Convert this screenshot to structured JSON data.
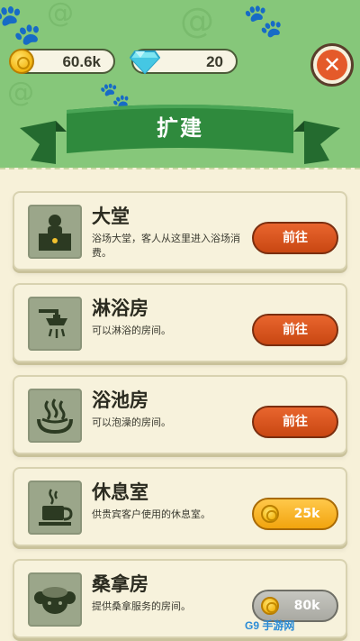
{
  "currency": {
    "coins": "60.6k",
    "diamonds": "20"
  },
  "header": {
    "title": "扩建"
  },
  "rooms": [
    {
      "name": "大堂",
      "desc": "浴场大堂，客人从这里进入浴场消费。",
      "action": "前往",
      "state": "go",
      "icon": "lobby-desk-icon"
    },
    {
      "name": "淋浴房",
      "desc": "可以淋浴的房间。",
      "action": "前往",
      "state": "go",
      "icon": "shower-icon"
    },
    {
      "name": "浴池房",
      "desc": "可以泡澡的房间。",
      "action": "前往",
      "state": "go",
      "icon": "hot-spring-icon"
    },
    {
      "name": "休息室",
      "desc": "供贵宾客户使用的休息室。",
      "action": "25k",
      "state": "buy",
      "icon": "coffee-cup-icon"
    },
    {
      "name": "桑拿房",
      "desc": "提供桑拿服务的房间。",
      "action": "80k",
      "state": "buy-disabled",
      "icon": "sauna-steam-icon"
    }
  ],
  "watermark": "G9 手游网",
  "colors": {
    "header_green": "#86c77a",
    "banner_green": "#2f8a3d",
    "go_button": "#d9521c",
    "buy_button": "#f6b31e",
    "disabled_button": "#b5b5ae",
    "close_button": "#e45a2a"
  }
}
